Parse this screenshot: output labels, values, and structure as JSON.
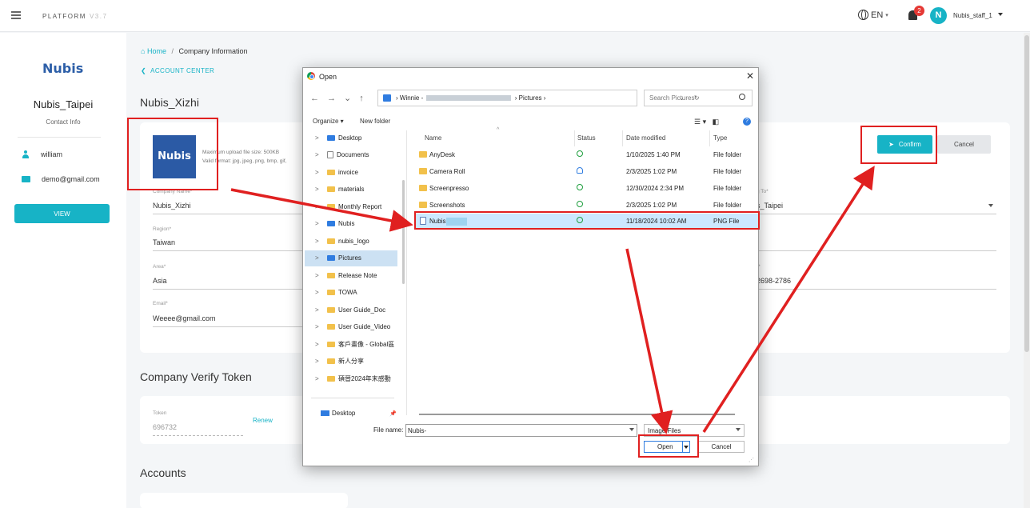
{
  "topbar": {
    "brand": "PLATFORM",
    "version": "V3.7",
    "language": "EN",
    "notification_count": "2",
    "avatar_initial": "N",
    "username": "Nubis_staff_1"
  },
  "sidebar": {
    "logo_text": "Nubis",
    "company_name": "Nubis_Taipei",
    "contact_label": "Contact Info",
    "contact_user": "william",
    "contact_email": "demo@gmail.com",
    "view_button": "VIEW"
  },
  "breadcrumb": {
    "home": "Home",
    "separator": "/",
    "current": "Company Information"
  },
  "back_link": "ACCOUNT CENTER",
  "company_title": "Nubis_Xizhi",
  "company_logo_text": "Nubis",
  "upload_hint": {
    "line1": "Maximum upload file size: 500KB",
    "line2": "Valid format: jpg, jpeg, png, bmp, gif,"
  },
  "form": {
    "company_name_label": "Company Name*",
    "company_name_value": "Nubis_Xizhi",
    "region_label": "Region*",
    "region_value": "Taiwan",
    "area_label": "Area*",
    "area_value": "Asia",
    "email_label": "Email*",
    "email_value": "Weeee@gmail.com",
    "belong_label": "g To*",
    "belong_value": "s_Taipei",
    "phone_label": "r*",
    "phone_value": "2698-2786"
  },
  "actions": {
    "confirm": "Confirm",
    "cancel": "Cancel"
  },
  "verify_section": {
    "title": "Company Verify Token",
    "token_label": "Token",
    "token_value": "696732",
    "renew": "Renew"
  },
  "accounts_title": "Accounts",
  "dialog": {
    "title": "Open",
    "close": "✕",
    "address_parts": [
      "Winnie -",
      "Pictures"
    ],
    "search_placeholder": "Search Pictures",
    "organize": "Organize ▾",
    "new_folder": "New folder",
    "tree": [
      {
        "label": "Desktop",
        "icon": "blue"
      },
      {
        "label": "Documents",
        "icon": "doc"
      },
      {
        "label": "invoice",
        "icon": "folder"
      },
      {
        "label": "materials",
        "icon": "folder"
      },
      {
        "label": "Monthly Report",
        "icon": "folder"
      },
      {
        "label": "Nubis",
        "icon": "blue"
      },
      {
        "label": "nubis_logo",
        "icon": "folder"
      },
      {
        "label": "Pictures",
        "icon": "blue",
        "selected": true
      },
      {
        "label": "Release Note",
        "icon": "folder"
      },
      {
        "label": "TOWA",
        "icon": "folder"
      },
      {
        "label": "User Guide_Doc",
        "icon": "folder"
      },
      {
        "label": "User Guide_Video",
        "icon": "folder"
      },
      {
        "label": "客戶畫像 - Global區",
        "icon": "folder"
      },
      {
        "label": "新人分享",
        "icon": "folder"
      },
      {
        "label": "碩晉2024年末感動",
        "icon": "folder"
      }
    ],
    "quick_access": "Desktop",
    "columns": {
      "name": "Name",
      "status": "Status",
      "date": "Date modified",
      "type": "Type"
    },
    "files": [
      {
        "name": "AnyDesk",
        "date": "1/10/2025 1:40 PM",
        "type": "File folder",
        "kind": "folder",
        "status": "ok"
      },
      {
        "name": "Camera Roll",
        "date": "2/3/2025 1:02 PM",
        "type": "File folder",
        "kind": "folder",
        "status": "cloud"
      },
      {
        "name": "Screenpresso",
        "date": "12/30/2024 2:34 PM",
        "type": "File folder",
        "kind": "folder",
        "status": "ok"
      },
      {
        "name": "Screenshots",
        "date": "2/3/2025 1:02 PM",
        "type": "File folder",
        "kind": "folder",
        "status": "ok"
      },
      {
        "name": "Nubis",
        "date": "11/18/2024 10:02 AM",
        "type": "PNG File",
        "kind": "png",
        "status": "ok",
        "selected": true
      }
    ],
    "file_name_label": "File name:",
    "file_name_value": "Nubis-",
    "file_type": "Image Files",
    "open_button": "Open",
    "cancel_button": "Cancel"
  },
  "colors": {
    "accent": "#17b3c6",
    "annotation": "#e02020",
    "brand_blue": "#2b5aa5"
  }
}
